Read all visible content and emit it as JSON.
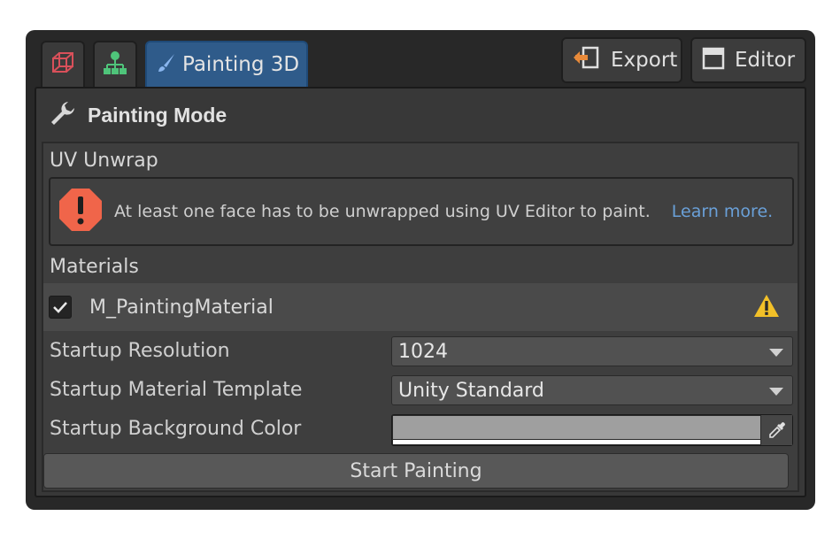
{
  "toolbar": {
    "tabs": [
      {
        "icon": "mesh-cube-icon",
        "color": "#d8505a"
      },
      {
        "icon": "hierarchy-icon",
        "color": "#4fc47a"
      },
      {
        "icon": "paintbrush-icon",
        "label": "Painting 3D",
        "color": "#8ab6ef",
        "active": true
      }
    ],
    "export_label": "Export",
    "editor_label": "Editor"
  },
  "panel": {
    "title": "Painting Mode",
    "title_icon": "wrench-icon"
  },
  "uv_unwrap": {
    "label": "UV Unwrap",
    "error_message": "At least one face has to be unwrapped using UV Editor to paint.",
    "learn_more": "Learn more.",
    "error_color": "#f0654a"
  },
  "materials": {
    "label": "Materials",
    "items": [
      {
        "name": "M_PaintingMaterial",
        "checked": true,
        "warning": true
      }
    ],
    "warning_color": "#f2c028"
  },
  "settings": {
    "resolution_label": "Startup Resolution",
    "resolution_value": "1024",
    "template_label": "Startup Material Template",
    "template_value": "Unity Standard",
    "bg_color_label": "Startup Background Color",
    "bg_color_value": "#9f9f9f"
  },
  "start_button_label": "Start Painting",
  "colors": {
    "window_bg": "#282828",
    "panel_bg": "#383838",
    "active_tab": "#2f5b8a",
    "link": "#6aa0d8"
  }
}
